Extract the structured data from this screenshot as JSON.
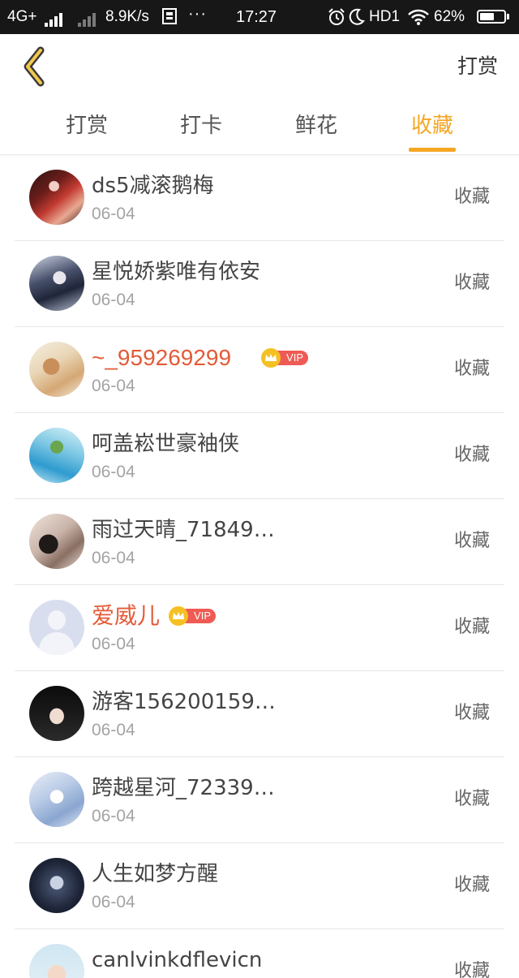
{
  "status_bar": {
    "network": "4G+",
    "speed": "8.9K/s",
    "time": "17:27",
    "hd": "HD1",
    "battery": "62%",
    "battery_level": 0.62
  },
  "header": {
    "action_label": "打赏"
  },
  "tabs": [
    {
      "label": "打赏",
      "active": false
    },
    {
      "label": "打卡",
      "active": false
    },
    {
      "label": "鲜花",
      "active": false
    },
    {
      "label": "收藏",
      "active": true
    }
  ],
  "accent_color": "#f5a623",
  "vip_name_color": "#e45a37",
  "list": [
    {
      "name": "ds5减滚鹅梅",
      "date": "06-04",
      "action": "收藏",
      "vip": false
    },
    {
      "name": "星悦娇紫唯有依安",
      "date": "06-04",
      "action": "收藏",
      "vip": false
    },
    {
      "name": "~_959269299",
      "date": "06-04",
      "action": "收藏",
      "vip": true,
      "vip_label": "VIP"
    },
    {
      "name": "呵盖崧世豪袖侠",
      "date": "06-04",
      "action": "收藏",
      "vip": false
    },
    {
      "name": "雨过天晴_71849…",
      "date": "06-04",
      "action": "收藏",
      "vip": false
    },
    {
      "name": "爱威儿",
      "date": "06-04",
      "action": "收藏",
      "vip": true,
      "vip_label": "VIP"
    },
    {
      "name": "游客156200159…",
      "date": "06-04",
      "action": "收藏",
      "vip": false
    },
    {
      "name": "跨越星河_72339…",
      "date": "06-04",
      "action": "收藏",
      "vip": false
    },
    {
      "name": "人生如梦方醒",
      "date": "06-04",
      "action": "收藏",
      "vip": false
    },
    {
      "name": "canlvinkdflevicn",
      "date": "",
      "action": "收藏",
      "vip": false
    }
  ]
}
